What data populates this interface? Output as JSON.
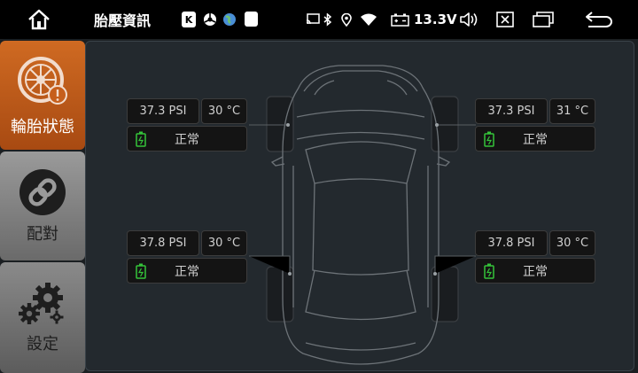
{
  "statusbar": {
    "title": "胎壓資訊",
    "notif_k": "K",
    "voltage": "13.3V",
    "icons": [
      "home-icon",
      "k-app-icon",
      "steering-wheel-icon",
      "globe-icon",
      "notification-square-icon",
      "cast-icon",
      "bluetooth-icon",
      "location-icon",
      "wifi-icon",
      "battery-icon",
      "volume-icon",
      "close-window-icon",
      "multi-window-icon",
      "back-icon"
    ]
  },
  "sidebar": {
    "items": [
      {
        "label": "輪胎狀態",
        "icon": "tire-icon",
        "active": true
      },
      {
        "label": "配對",
        "icon": "link-icon",
        "active": false
      },
      {
        "label": "設定",
        "icon": "gears-icon",
        "active": false
      }
    ]
  },
  "tires": {
    "front_left": {
      "pressure": "37.3 PSI",
      "temperature": "30 °C",
      "status": "正常"
    },
    "front_right": {
      "pressure": "37.3 PSI",
      "temperature": "31 °C",
      "status": "正常"
    },
    "rear_left": {
      "pressure": "37.8 PSI",
      "temperature": "30 °C",
      "status": "正常"
    },
    "rear_right": {
      "pressure": "37.8 PSI",
      "temperature": "30 °C",
      "status": "正常"
    }
  },
  "colors": {
    "accent": "#c65f1c",
    "battery_ok": "#35c43a",
    "panel": "#23292e"
  }
}
